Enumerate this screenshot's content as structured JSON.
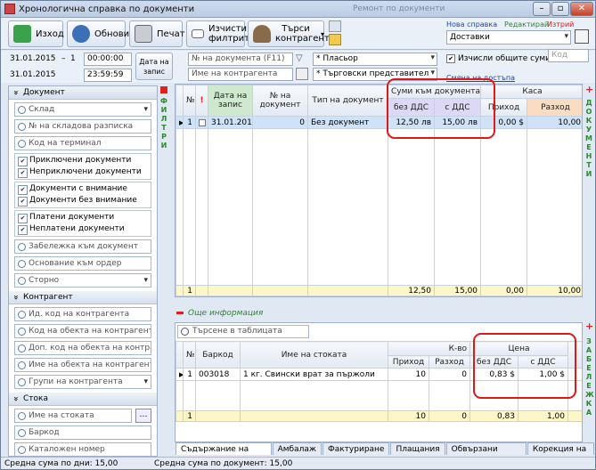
{
  "window": {
    "title": "Хронологична справка по документи",
    "ghost_title": "Ремонт по документи"
  },
  "toolbar": {
    "exit_label": "Изход",
    "refresh_label": "Обнови",
    "print_label": "Печат",
    "clear_filters_label": "Изчисти филтрите",
    "find_partner_label": "Търси контрагент"
  },
  "report": {
    "new_label": "Нова справка",
    "edit_label": "Редактирай",
    "delete_label": "Изтрий",
    "selected": "Доставки",
    "calc_sums_label": "Изчисли общите суми",
    "code_placeholder": "Код",
    "change_access_label": "Смяна на достъпа"
  },
  "filters": {
    "date_from": "31.01.2015",
    "date_to": "31.01.2015",
    "day_count": "1",
    "time_from": "00:00:00",
    "time_to": "23:59:59",
    "date_mode_label": "Дата на запис",
    "doc_number_placeholder": "№ на документа (F11)",
    "partner_name_placeholder": "Име на контрагента",
    "placement": "* Пласьор",
    "sales_rep": "* Търговски представител"
  },
  "left_panel": {
    "document_section": "Документ",
    "warehouse": "Склад",
    "warehouse_receipt": "№ на складова разписка",
    "terminal_code": "Код на терминал",
    "group1": [
      "Приключени документи",
      "Неприключени документи"
    ],
    "group2": [
      "Документи с внимание",
      "Документи без внимание"
    ],
    "group3": [
      "Платени документи",
      "Неплатени документи"
    ],
    "doc_note": "Забележка към документ",
    "order_basis": "Основание към ордер",
    "storno": "Сторно",
    "partner_section": "Контрагент",
    "partner_id": "Ид. код на контрагента",
    "partner_object_code": "Код на обекта на контрагента",
    "partner_object_extra_code": "Доп. код на обекта на контрагента",
    "partner_object_name": "Име на обекта на контрагента",
    "partner_groups": "Групи на контрагента",
    "goods_section": "Стока",
    "goods_name": "Име на стоката",
    "barcode": "Баркод",
    "catalog_number": "Каталожен номер"
  },
  "side_tabs": {
    "filters": "ФИЛТРИ",
    "documents": "ДОКУМЕНТИ",
    "note": "ЗАБЕЛЕЖКА"
  },
  "doc_grid": {
    "headers": {
      "num": "№",
      "attention": "!",
      "date": "Дата на запис",
      "doc_number": "№ на документ",
      "doc_type": "Тип на документ",
      "sums_group": "Суми към документа",
      "without_vat": "без ДДС",
      "with_vat": "с ДДС",
      "cash_group": "Каса",
      "income": "Приход",
      "expense": "Разход"
    },
    "row": {
      "num": "1",
      "date": "31.01.2015",
      "doc_number": "0",
      "doc_type": "Без документ",
      "without_vat": "12,50 лв",
      "with_vat": "15,00 лв",
      "income": "0,00 $",
      "expense": "10,00"
    },
    "totals": {
      "count": "1",
      "without_vat": "12,50",
      "with_vat": "15,00",
      "income": "0,00",
      "expense": "10,00"
    }
  },
  "more_info": {
    "label": "Още информация",
    "search_placeholder": "Търсене в таблицата"
  },
  "items_grid": {
    "headers": {
      "num": "№",
      "barcode": "Баркод",
      "goods_name": "Име на стоката",
      "qty_group": "К-во",
      "income": "Приход",
      "expense": "Разход",
      "price_group": "Цена",
      "without_vat": "без ДДС",
      "with_vat": "с ДДС"
    },
    "row": {
      "num": "1",
      "barcode": "003018",
      "goods_name": "1 кг. Свински врат за пържоли",
      "income": "10",
      "expense": "0",
      "without_vat": "0,83 $",
      "with_vat": "1,00 $"
    },
    "totals": {
      "count": "1",
      "income": "10",
      "expense": "0",
      "without_vat": "0,83",
      "with_vat": "1,00"
    }
  },
  "bottom_tabs": [
    "Съдържание на документа",
    "Амбалаж",
    "Фактуриране",
    "Плащания",
    "Обвързани документи",
    "Корекция на цена"
  ],
  "status": {
    "per_day": "Средна сума по дни: 15,00",
    "per_document": "Средна сума по документ: 15,00"
  }
}
